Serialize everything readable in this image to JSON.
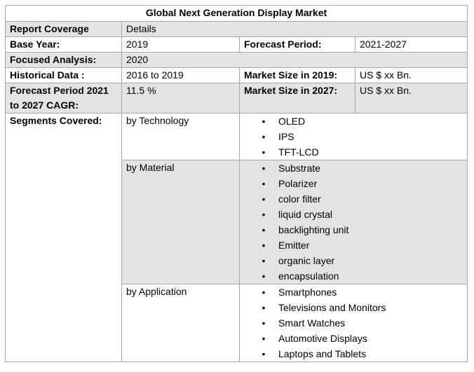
{
  "title": "Global Next Generation Display Market",
  "header": {
    "label": "Report Coverage",
    "value": "Details"
  },
  "base_year": {
    "label": "Base Year:",
    "value": "2019"
  },
  "forecast_period": {
    "label": "Forecast Period:",
    "value": "2021-2027"
  },
  "focused_analysis": {
    "label": "Focused Analysis:",
    "value": "2020"
  },
  "historical_data": {
    "label": "Historical Data :",
    "value": "2016 to 2019"
  },
  "market_size_2019": {
    "label": "Market Size in 2019:",
    "value": "US $ xx Bn."
  },
  "cagr": {
    "label": "Forecast Period 2021 to 2027 CAGR:",
    "value": "11.5 %"
  },
  "market_size_2027": {
    "label": "Market Size in 2027:",
    "value": "US $ xx Bn."
  },
  "segments": {
    "label": "Segments Covered:",
    "bullet": "•",
    "groups": [
      {
        "name": "by Technology",
        "items": [
          "OLED",
          "IPS",
          "TFT-LCD"
        ]
      },
      {
        "name": "by Material",
        "items": [
          "Substrate",
          "Polarizer",
          "color filter",
          "liquid crystal",
          "backlighting unit",
          "Emitter",
          "organic layer",
          "encapsulation"
        ]
      },
      {
        "name": "by Application",
        "items": [
          "Smartphones",
          "Televisions and Monitors",
          "Smart Watches",
          "Automotive Displays",
          "Laptops and Tablets"
        ]
      }
    ]
  }
}
